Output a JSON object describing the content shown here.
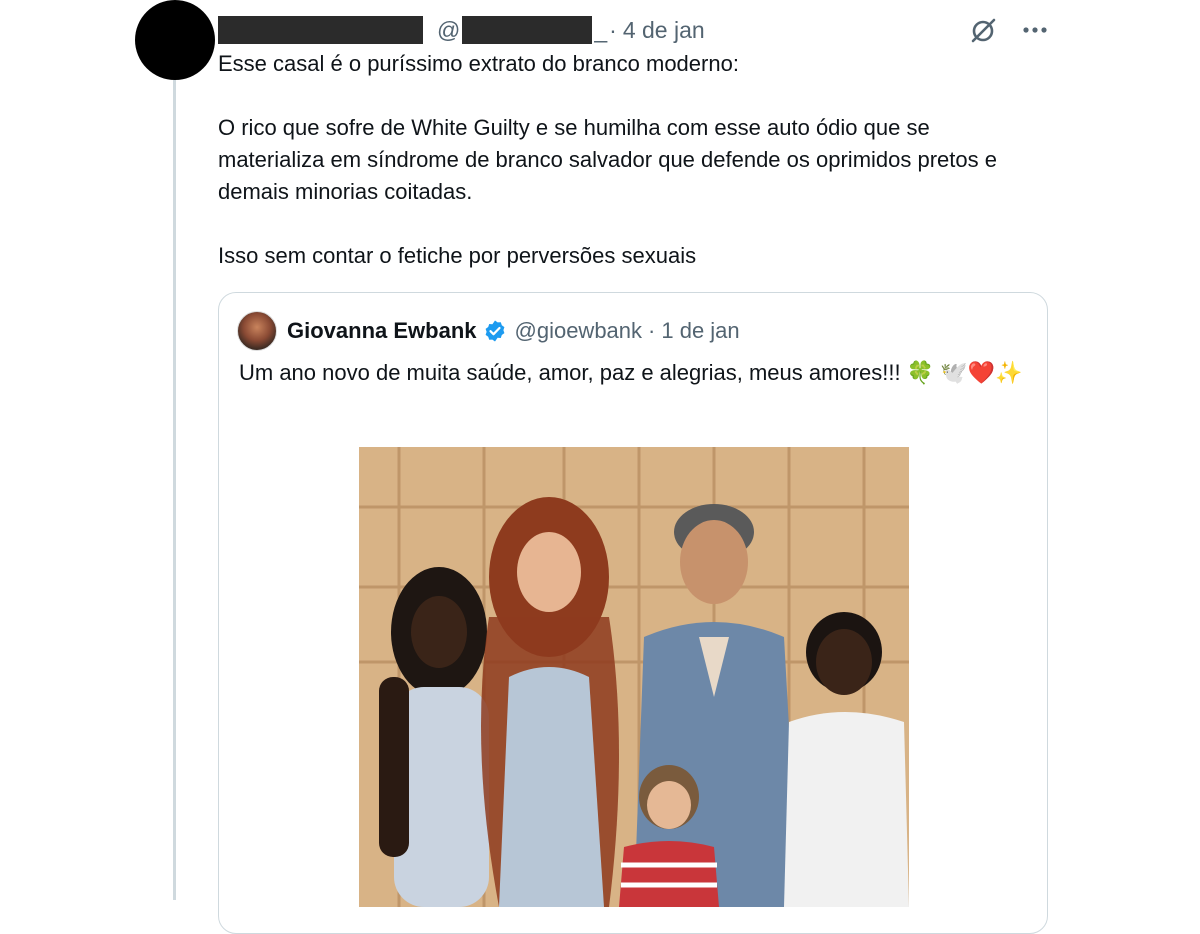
{
  "post": {
    "handle_prefix": "@",
    "handle_suffix": "_",
    "separator": "·",
    "date": "4 de jan",
    "more_icon": "more-horizontal-icon",
    "grok_icon": "slashed-circle-icon",
    "paragraphs": [
      "Esse casal é o puríssimo extrato do branco moderno:",
      "O rico que sofre de White Guilty e se humilha com esse auto ódio que se materializa em síndrome de branco salvador que defende os oprimidos pretos e demais minorias coitadas.",
      "Isso sem contar o fetiche por perversões sexuais"
    ]
  },
  "quote": {
    "name": "Giovanna Ewbank",
    "handle": "@gioewbank",
    "separator": "·",
    "date": "1 de jan",
    "text": "Um ano novo de muita saúde, amor, paz e alegrias, meus amores!!! 🍀 🕊️❤️✨",
    "verified_color": "#1d9bf0"
  },
  "colors": {
    "text": "#0f1419",
    "secondary": "#536471",
    "border": "#cfd9de"
  }
}
